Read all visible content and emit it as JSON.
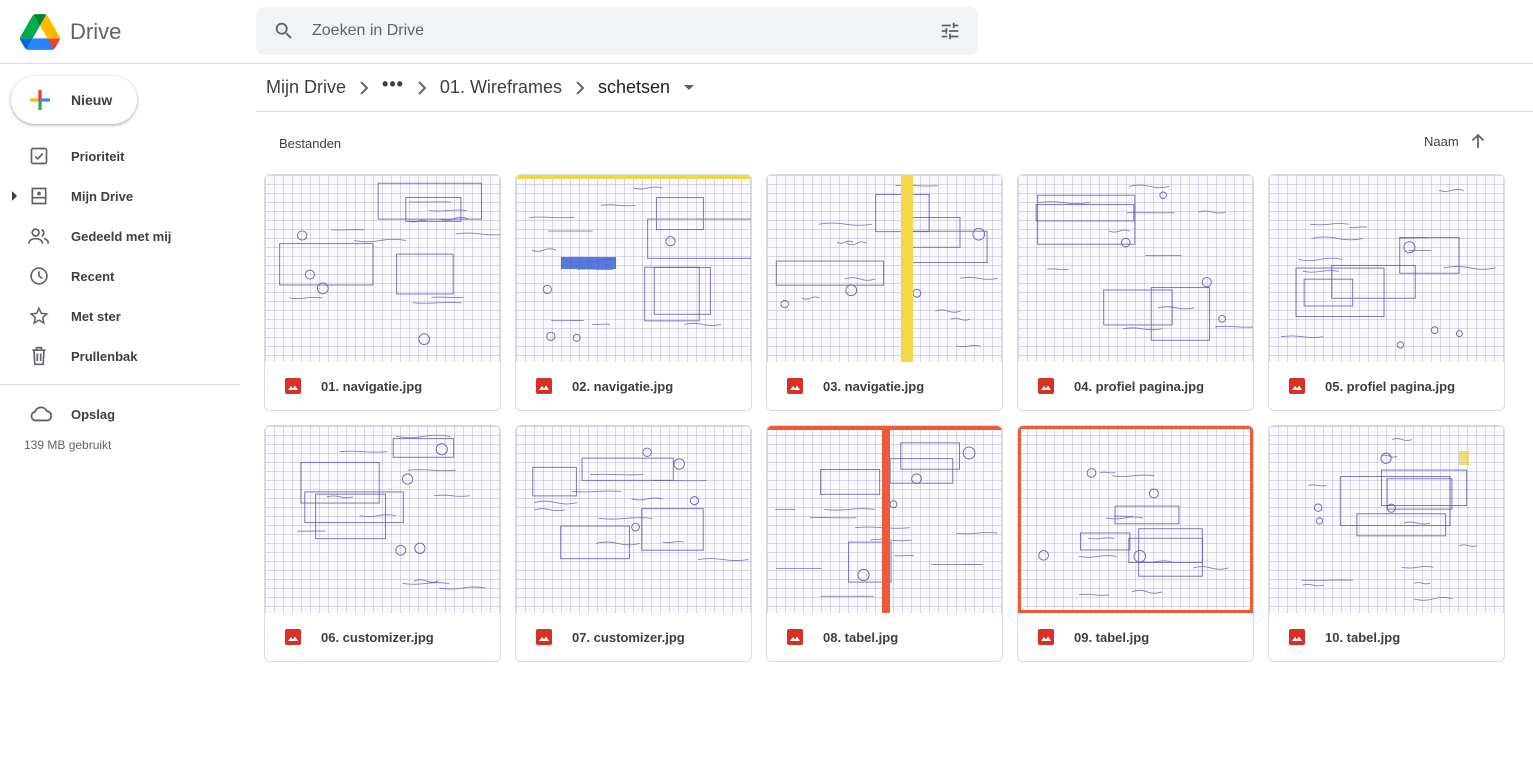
{
  "app": {
    "logo_text": "Drive"
  },
  "search": {
    "placeholder": "Zoeken in Drive"
  },
  "sidebar": {
    "new_label": "Nieuw",
    "items": [
      {
        "label": "Prioriteit",
        "icon": "priority-icon"
      },
      {
        "label": "Mijn Drive",
        "icon": "my-drive-icon"
      },
      {
        "label": "Gedeeld met mij",
        "icon": "shared-icon"
      },
      {
        "label": "Recent",
        "icon": "clock-icon"
      },
      {
        "label": "Met ster",
        "icon": "star-icon"
      },
      {
        "label": "Prullenbak",
        "icon": "trash-icon"
      }
    ],
    "storage_label": "Opslag",
    "storage_used": "139 MB gebruikt"
  },
  "breadcrumb": {
    "root": "Mijn Drive",
    "more": "•••",
    "folder": "01. Wireframes",
    "current": "schetsen"
  },
  "main": {
    "section_label": "Bestanden",
    "sort_label": "Naam"
  },
  "files": [
    {
      "name": "01. navigatie.jpg"
    },
    {
      "name": "02. navigatie.jpg"
    },
    {
      "name": "03. navigatie.jpg"
    },
    {
      "name": "04. profiel pagina.jpg"
    },
    {
      "name": "05. profiel pagina.jpg"
    },
    {
      "name": "06. customizer.jpg"
    },
    {
      "name": "07. customizer.jpg"
    },
    {
      "name": "08. tabel.jpg"
    },
    {
      "name": "09. tabel.jpg"
    },
    {
      "name": "10. tabel.jpg"
    }
  ],
  "colors": {
    "accent": "#1a73e8",
    "image_icon": "#d93025",
    "sketch_ink": "#6a5fb0"
  }
}
